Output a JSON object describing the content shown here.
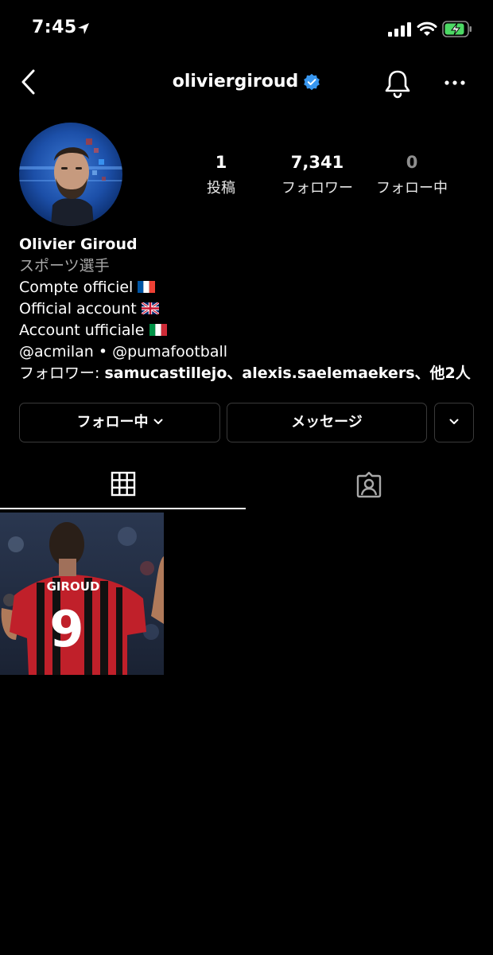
{
  "status_bar": {
    "time": "7:45"
  },
  "header": {
    "username": "oliviergiroud",
    "verified": true
  },
  "stats": {
    "posts": {
      "value": "1",
      "label": "投稿"
    },
    "followers": {
      "value": "7,341",
      "label": "フォロワー"
    },
    "following": {
      "value": "0",
      "label": "フォロー中"
    }
  },
  "bio": {
    "name": "Olivier Giroud",
    "category": "スポーツ選手",
    "line1": "Compte officiel",
    "line2": "Official account",
    "line3": "Account ufficiale",
    "mentions": "@acmilan • @pumafootball",
    "followed_by_prefix": "フォロワー: ",
    "followed_by_names": "samucastillejo、alexis.saelemaekers、他2人"
  },
  "buttons": {
    "following_label": "フォロー中",
    "message_label": "メッセージ"
  },
  "post": {
    "jersey_name": "GIROUD",
    "jersey_number": "9"
  },
  "colors": {
    "background": "#000000",
    "verified_blue": "#3897f0",
    "button_border": "#3a3a3a",
    "battery_green": "#4cd964"
  },
  "icons": [
    "location-arrow-icon",
    "signal-icon",
    "wifi-icon",
    "battery-charging-icon",
    "back-chevron-icon",
    "verified-badge-icon",
    "bell-icon",
    "more-icon",
    "chevron-down-icon",
    "grid-icon",
    "tagged-icon",
    "flag-fr-icon",
    "flag-uk-icon",
    "flag-it-icon"
  ]
}
